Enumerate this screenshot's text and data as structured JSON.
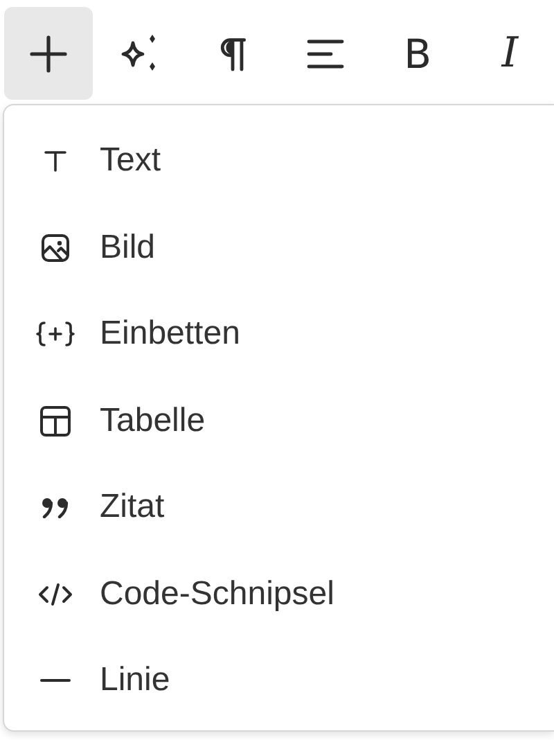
{
  "toolbar": [
    {
      "kind": "plus",
      "selected": true
    },
    {
      "kind": "sparkle",
      "selected": false
    },
    {
      "kind": "pilcrow",
      "selected": false
    },
    {
      "kind": "align",
      "selected": false
    },
    {
      "kind": "bold",
      "label": "B",
      "selected": false
    },
    {
      "kind": "italic",
      "label": "I",
      "selected": false
    }
  ],
  "menu": {
    "items": [
      {
        "kind": "text",
        "label": "Text"
      },
      {
        "kind": "image",
        "label": "Bild"
      },
      {
        "kind": "embed",
        "label": "Einbetten"
      },
      {
        "kind": "table",
        "label": "Tabelle"
      },
      {
        "kind": "quote",
        "label": "Zitat"
      },
      {
        "kind": "code",
        "label": "Code-Schnipsel"
      },
      {
        "kind": "line",
        "label": "Linie"
      }
    ]
  }
}
